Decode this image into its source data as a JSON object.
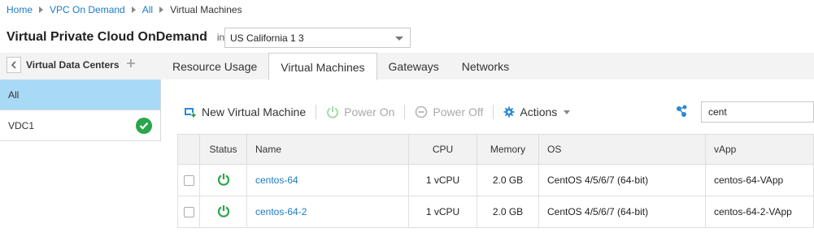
{
  "breadcrumb": {
    "items": [
      "Home",
      "VPC On Demand",
      "All"
    ],
    "current": "Virtual Machines"
  },
  "header": {
    "title": "Virtual Private Cloud OnDemand",
    "in_label": "in",
    "region_value": "US California 1 3"
  },
  "sidebar": {
    "title": "Virtual Data Centers",
    "items": [
      {
        "label": "All",
        "selected": true
      },
      {
        "label": "VDC1",
        "status": "check-circle-icon"
      }
    ]
  },
  "tabs": [
    {
      "label": "Resource Usage",
      "active": false
    },
    {
      "label": "Virtual Machines",
      "active": true
    },
    {
      "label": "Gateways",
      "active": false
    },
    {
      "label": "Networks",
      "active": false
    }
  ],
  "toolbar": {
    "new_vm": "New Virtual Machine",
    "power_on": "Power On",
    "power_off": "Power Off",
    "actions": "Actions"
  },
  "search": {
    "value": "cent"
  },
  "table": {
    "columns": [
      "Status",
      "Name",
      "CPU",
      "Memory",
      "OS",
      "vApp"
    ],
    "rows": [
      {
        "status": "power-icon",
        "name": "centos-64",
        "cpu": "1 vCPU",
        "memory": "2.0 GB",
        "os": "CentOS 4/5/6/7 (64-bit)",
        "vapp": "centos-64-VApp"
      },
      {
        "status": "power-icon",
        "name": "centos-64-2",
        "cpu": "1 vCPU",
        "memory": "2.0 GB",
        "os": "CentOS 4/5/6/7 (64-bit)",
        "vapp": "centos-64-2-VApp"
      }
    ]
  },
  "colors": {
    "link": "#1a7bc7",
    "selected_bg": "#a8daf6",
    "power_on_green": "#2aa54b",
    "disabled": "#a9a9a9"
  }
}
